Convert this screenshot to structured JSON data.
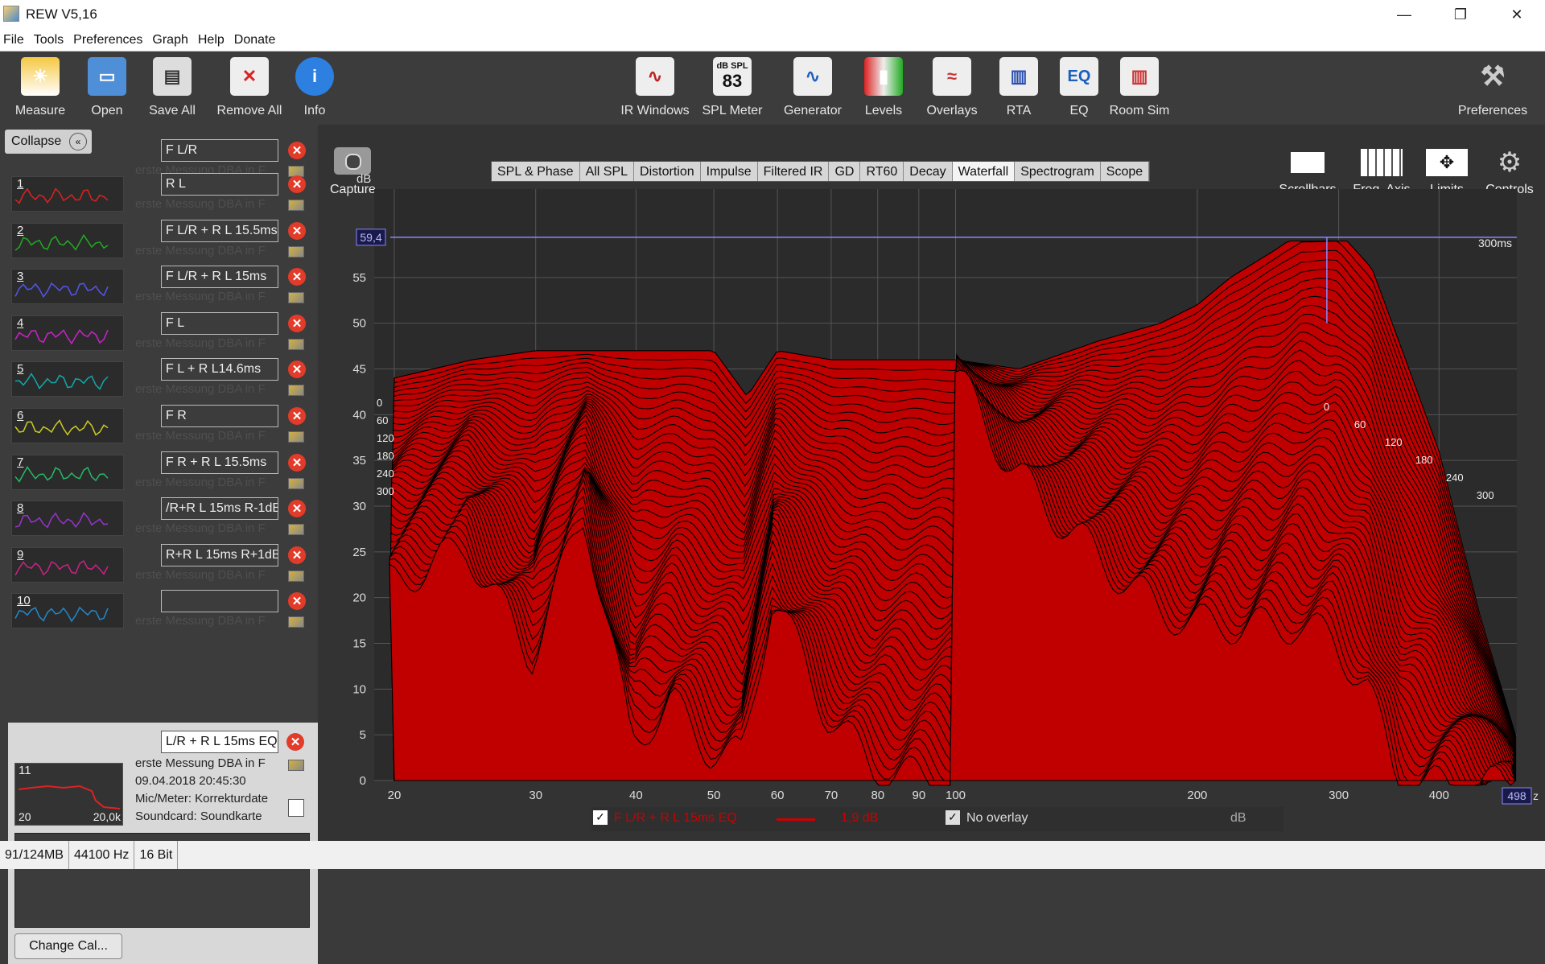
{
  "window": {
    "title": "REW V5,16"
  },
  "menu": [
    "File",
    "Tools",
    "Preferences",
    "Graph",
    "Help",
    "Donate"
  ],
  "toolbar": [
    {
      "label": "Measure",
      "icon": "measure-icon"
    },
    {
      "label": "Open",
      "icon": "folder-icon"
    },
    {
      "label": "Save All",
      "icon": "save-icon"
    },
    {
      "label": "Remove All",
      "icon": "remove-icon"
    },
    {
      "label": "Info",
      "icon": "info-icon"
    },
    {
      "label": "IR Windows",
      "icon": "ir-windows-icon"
    },
    {
      "label": "SPL Meter",
      "icon": "spl-meter-icon",
      "top": "dB SPL",
      "value": "83"
    },
    {
      "label": "Generator",
      "icon": "generator-icon"
    },
    {
      "label": "Levels",
      "icon": "levels-icon"
    },
    {
      "label": "Overlays",
      "icon": "overlays-icon"
    },
    {
      "label": "RTA",
      "icon": "rta-icon"
    },
    {
      "label": "EQ",
      "icon": "eq-icon"
    },
    {
      "label": "Room Sim",
      "icon": "room-sim-icon"
    },
    {
      "label": "Preferences",
      "icon": "preferences-icon"
    }
  ],
  "sidebar": {
    "collapse": "Collapse",
    "first_name": "F L/R",
    "ghost": "erste Messung DBA in F",
    "items": [
      {
        "n": "1",
        "name": "R L",
        "color": "#d22"
      },
      {
        "n": "2",
        "name": "F L/R + R L 15.5ms",
        "color": "#2a2"
      },
      {
        "n": "3",
        "name": "F L/R + R L 15ms",
        "color": "#55e"
      },
      {
        "n": "4",
        "name": "F L",
        "color": "#c2c"
      },
      {
        "n": "5",
        "name": "F L + R L14.6ms",
        "color": "#1aa"
      },
      {
        "n": "6",
        "name": "F R",
        "color": "#cc2"
      },
      {
        "n": "7",
        "name": "F R + R L 15.5ms",
        "color": "#2b6"
      },
      {
        "n": "8",
        "name": "/R+R L 15ms R-1dB",
        "color": "#93c"
      },
      {
        "n": "9",
        "name": "R+R L 15ms R+1dB",
        "color": "#c28"
      },
      {
        "n": "10",
        "name": "",
        "color": "#28c"
      }
    ],
    "selected": {
      "n": "11",
      "name": "L/R + R L 15ms EQ",
      "info": [
        "erste Messung DBA in F",
        "09.04.2018 20:45:30",
        "Mic/Meter: Korrekturdate",
        "Soundcard: Soundkarte"
      ],
      "xmin": "20",
      "xmax": "20,0k"
    },
    "change_cal": "Change Cal..."
  },
  "graph": {
    "capture": "Capture",
    "tabs": [
      "SPL & Phase",
      "All SPL",
      "Distortion",
      "Impulse",
      "Filtered IR",
      "GD",
      "RT60",
      "Decay",
      "Waterfall",
      "Spectrogram",
      "Scope"
    ],
    "active_tab": "Waterfall",
    "buttons": [
      "Scrollbars",
      "Freq. Axis",
      "Limits",
      "Controls"
    ],
    "y_unit": "dB",
    "y_top_value": "59,4",
    "x_right_value": "498",
    "x_right_suffix": "z",
    "time_label": "300ms",
    "time_slices": [
      "0",
      "60",
      "120",
      "180",
      "240",
      "300"
    ],
    "legend": {
      "series": "F L/R + R L 15ms EQ",
      "db": "1,9 dB",
      "overlay": "No overlay",
      "unit": "dB"
    }
  },
  "chart_data": {
    "type": "area",
    "title": "",
    "ylabel": "dB",
    "xlabel": "",
    "x_scale": "log",
    "ylim": [
      0,
      60
    ],
    "xlim": [
      20,
      500
    ],
    "yticks": [
      0,
      5,
      10,
      15,
      20,
      25,
      30,
      35,
      40,
      45,
      50,
      55
    ],
    "xticks": [
      20,
      30,
      40,
      50,
      60,
      70,
      80,
      90,
      100,
      200,
      300,
      400
    ],
    "back_slice": {
      "label": "0 ms",
      "x": [
        20,
        25,
        30,
        35,
        40,
        45,
        50,
        55,
        60,
        70,
        80,
        100,
        120,
        150,
        180,
        200,
        220,
        250,
        270,
        300,
        330,
        360,
        400,
        450,
        498
      ],
      "y": [
        44,
        46,
        47,
        47,
        47,
        47,
        47,
        42,
        47,
        46,
        46,
        46,
        45,
        48,
        50,
        52,
        55,
        58,
        60,
        60,
        56,
        47,
        36,
        18,
        5
      ]
    },
    "front_slice": {
      "label": "300 ms",
      "x": [
        20,
        25,
        30,
        35,
        40,
        45,
        50,
        55,
        60,
        70,
        80,
        100
      ],
      "y": [
        22,
        26,
        14,
        30,
        5,
        9,
        4,
        3,
        21,
        8,
        2,
        0
      ]
    },
    "series_color": "#c00000"
  },
  "status": [
    "91/124MB",
    "44100 Hz",
    "16 Bit"
  ]
}
